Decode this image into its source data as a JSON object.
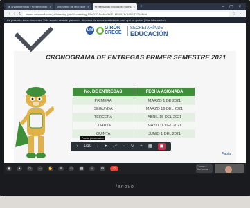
{
  "browser": {
    "tabs": [
      {
        "label": "Mi chat extendido / Presentando"
      },
      {
        "label": "Mi registro de Microsoft"
      },
      {
        "label": "Presentando Microsoft Teams"
      }
    ],
    "url": "teams.microsoft.com/_#/l/meetup-join/19:meeting_NDc0ZDAxMmEtYjE1MS00ZDJlLWE2ZGUtNmI",
    "banner": "Se presenta en su momento. Este evento se está grabando. Al unirse da su consentimiento para que se graba. (Más información)"
  },
  "slide": {
    "logo_uri": "URI",
    "logo_gc_line1": "GIRÓN",
    "logo_gc_line2": "CRECE",
    "secretaria_line1": "SECRETARÍA DE",
    "secretaria_line2": "EDUCACIÓN",
    "title": "CRONOGRAMA DE ENTREGAS PRIMER SEMESTRE 2021",
    "table": {
      "headers": [
        "No. DE ENTREGAS",
        "FECHA ASIGNADA"
      ],
      "rows": [
        [
          "PRIMERA",
          "MARZO 1 DE 2021"
        ],
        [
          "SEGUNDA",
          "MARZO 16 DEL 2021"
        ],
        [
          "TERCERA",
          "ABRIL 15 DEL 2021"
        ],
        [
          "CUARTA",
          "MAYO 11 DEL 2021"
        ],
        [
          "QUINTA",
          "JUNIO 1 DEL 2021"
        ]
      ]
    },
    "footer_logo": "Paola"
  },
  "presenter_controls": {
    "tooltip": "Pausar presentación",
    "page": "1/10"
  },
  "meeting_bar": {
    "participant_label": "Carmen / Camarena"
  },
  "laptop_brand": "lenovo"
}
